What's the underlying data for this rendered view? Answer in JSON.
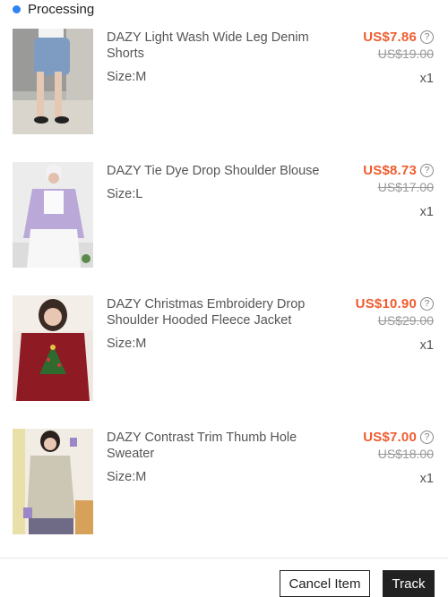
{
  "order": {
    "status": "Processing",
    "status_color": "#2e83f5"
  },
  "items": [
    {
      "title": "DAZY Light Wash Wide Leg Denim Shorts",
      "size": "Size:M",
      "price": "US$7.86",
      "original_price": "US$19.00",
      "quantity": "x1",
      "image": "photo of model in light wash denim shorts"
    },
    {
      "title": "DAZY Tie Dye Drop Shoulder Blouse",
      "size": "Size:L",
      "price": "US$8.73",
      "original_price": "US$17.00",
      "quantity": "x1",
      "image": "photo of model in lilac tie dye blouse"
    },
    {
      "title": "DAZY Christmas Embroidery Drop Shoulder Hooded Fleece Jacket",
      "size": "Size:M",
      "price": "US$10.90",
      "original_price": "US$29.00",
      "quantity": "x1",
      "image": "photo of model in burgundy hooded fleece jacket"
    },
    {
      "title": "DAZY Contrast Trim Thumb Hole Sweater",
      "size": "Size:M",
      "price": "US$7.00",
      "original_price": "US$18.00",
      "quantity": "x1",
      "image": "photo of model in beige sweater with purple trim"
    }
  ],
  "price_color": "#ee5d2f",
  "help_icon": "question-circle-icon",
  "actions": {
    "cancel_label": "Cancel Item",
    "track_label": "Track"
  }
}
